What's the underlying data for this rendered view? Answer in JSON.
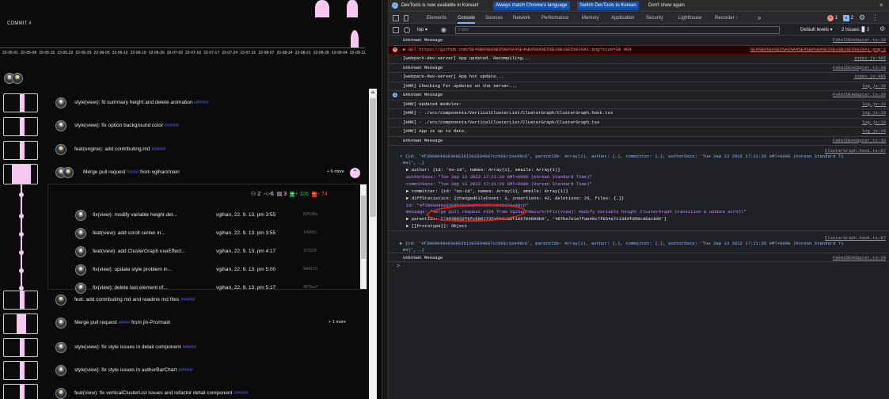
{
  "app": {
    "commit_axis_label": "COMMIT #",
    "date_ticks": [
      "22-05-01",
      "22-05-08",
      "22-05-15",
      "22-05-22",
      "22-05-29",
      "22-06-05",
      "22-06-12",
      "22-06-19",
      "22-06-26",
      "22-07-03",
      "22-07-10",
      "22-07-17",
      "22-07-24",
      "22-07-31",
      "22-08-07",
      "22-08-14",
      "22-08-21",
      "22-08-28",
      "22-09-04",
      "22-09-11"
    ],
    "accent_color": "#f8c8f2",
    "link_color": "#5a62ff",
    "commits_top": [
      {
        "message": "style(view): fit summary height and delete animation"
      },
      {
        "message": "style(view): fix option background color"
      },
      {
        "message": "feat(engine): add contributing.md"
      }
    ],
    "expanded": {
      "message_prefix": "Merge pull request",
      "message_suffix": "from vgihan/main",
      "more_label": "+ 6 more",
      "stats": {
        "authors": "2",
        "commits": "6",
        "files": "3",
        "additions": "+ 106",
        "deletions": "− 74"
      },
      "sub_commits": [
        {
          "message": "fix(view): modify variable height det...",
          "author": "vgihan, 22. 9. 13. pm 3:55",
          "hash": "82538a"
        },
        {
          "message": "feat(view): add scroll center in...",
          "author": "vgihan, 22. 9. 13. pm 3:55",
          "hash": "14091c"
        },
        {
          "message": "feat(view): add ClusterGraph useEffect...",
          "author": "vgihan, 22. 9. 13. pm 4:17",
          "hash": "37232f"
        },
        {
          "message": "fix(view): update style problem in...",
          "author": "vgihan, 22. 9. 13. pm 5:00",
          "hash": "944113"
        },
        {
          "message": "fix(view): delete last element of...",
          "author": "vgihan, 22. 9. 13. pm 5:17",
          "hash": "487be7"
        }
      ]
    },
    "commits_bottom": [
      {
        "message": "feat: add contributing md and readme md files",
        "more": ""
      },
      {
        "message_prefix": "Merge pull request",
        "message_suffix": "from jin-Pro/main",
        "more": "+ 1 more"
      },
      {
        "message": "style(view): fix style issues in detail component",
        "more": ""
      },
      {
        "message": "style(view): fix style issues in authorBarChart",
        "more": ""
      },
      {
        "message": "feat(view): fix verticalClusterList issues and refactor detail component",
        "more": ""
      }
    ]
  },
  "devtools": {
    "infobar": {
      "text": "DevTools is now available in Korean!",
      "btn_match": "Always match Chrome's language",
      "btn_switch": "Switch DevTools to Korean",
      "dont_show": "Don't show again"
    },
    "tabs": [
      "Elements",
      "Console",
      "Sources",
      "Network",
      "Performance",
      "Memory",
      "Application",
      "Security",
      "Lighthouse",
      "Recorder ↑"
    ],
    "active_tab": "Console",
    "more_tabs": "»",
    "badges": {
      "errors": "1",
      "issues_count": "2"
    },
    "filter": {
      "context": "top",
      "placeholder": "Filter",
      "levels": "Default levels ▾",
      "issues": "2 Issues: ▊ 2"
    },
    "messages": [
      {
        "text": "Unknown Message",
        "source": "FakeIDEAdapter.ts:39",
        "type": "log"
      },
      {
        "text": "▶ GET https://github.com/%E4%BA%9A%E6%A6%A4%E4%BA%9A%E5%B1%B1%E5%93%A1.png?size=30 404",
        "source": "%E4%BA%9A%E6%A6%A4%E4%BA%9A%E5%B1%B1%E5%93%A1.png:1",
        "type": "error"
      },
      {
        "text": "[webpack-dev-server] App updated. Recompiling...",
        "source": "index.js:485",
        "type": "log"
      },
      {
        "text": "Unknown Message",
        "source": "FakeIDEAdapter.ts:39",
        "type": "log"
      },
      {
        "text": "[webpack-dev-server] App hot update...",
        "source": "index.js:485",
        "type": "log"
      },
      {
        "text": "[HMR] Checking for updates on the server...",
        "source": "log.js:39",
        "type": "log"
      },
      {
        "text": "Unknown Message",
        "source": "FakeIDEAdapter.ts:39",
        "type": "info"
      },
      {
        "text": "[HMR] Updated modules:",
        "source": "log.js:39",
        "type": "log"
      },
      {
        "text": "[HMR]  - ./src/components/VerticalClusterList/ClusterGraph/ClusterGraph.hook.tsx",
        "source": "log.js:39",
        "type": "log"
      },
      {
        "text": "[HMR]  - ./src/components/VerticalClusterList/ClusterGraph/ClusterGraph.tsx",
        "source": "log.js:39",
        "type": "log"
      },
      {
        "text": "[HMR] App is up to date.",
        "source": "log.js:39",
        "type": "log"
      },
      {
        "text": "Unknown Message",
        "source": "FakeIDEAdapter.ts:39",
        "type": "log"
      }
    ],
    "object": {
      "source": "ClusterGraph.hook.ts:87",
      "summary": "▾ {id: '4f3900d48a93e863613e2894087ccb01c1ea48c6', parentIds: Array(2), author: {…}, committer: {…}, authorDate: 'Tue Sep 13 2022 17:21:26 GMT+0900 (Korean Standard Ti",
      "summary2": "me)', …}",
      "lines": [
        "▶ author: {id: 'no-id', names: Array(1), emails: Array(1)}",
        "   authorDate: \"Tue Sep 13 2022 17:21:26 GMT+0900 (Korean Standard Time)\"",
        "   commitDate: \"Tue Sep 13 2022 17:21:26 GMT+0900 (Korean Standard Time)\"",
        "▶ committer: {id: 'no-id', names: Array(1), emails: Array(1)}",
        "▶ diffStatistics: {changedFileCount: 3, insertions: 42, deletions: 26, files: {…}}",
        "   id: \"4f3900d48a93e863613e2894087ccb01c1ea48c6\"",
        "   message: \"Merge pull request #159 from vgihan/main/n/nfix(view): modify variable height ClusterGraph transition & update scroll\"",
        "▶ parentIds: ['8939032f6fc6967735abb9e8ef1067b9890b9', '487be7e1e7fae48c7fb54a7c13ddf059cd6ac8d6']",
        "▶ [[Prototype]]: Object"
      ]
    },
    "object2": {
      "source": "ClusterGraph.hook.ts:87",
      "summary": "▶ {id: '4f3900d48a93e863613e2894087ccb01c1ea48c6', parentIds: Array(2), author: {…}, committer: {…}, authorDate: 'Tue Sep 13 2022 17:21:26 GMT+0900 (Korean Standard Ti",
      "summary2": "me)', …}"
    },
    "last_message": {
      "text": "Unknown Message",
      "source": "FakeIDEAdapter.ts:39"
    },
    "prompt": ">"
  }
}
